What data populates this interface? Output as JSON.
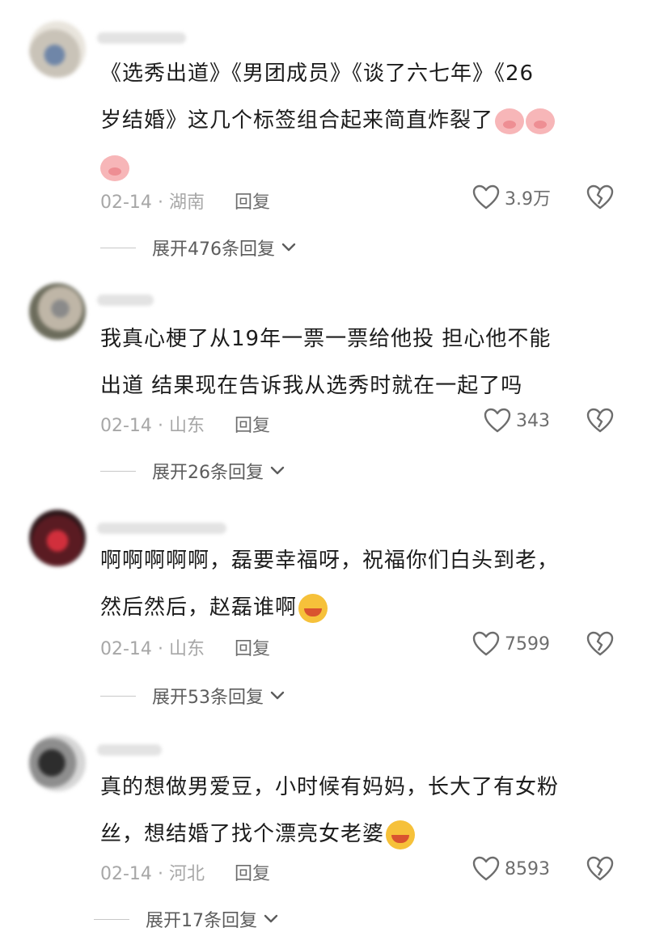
{
  "comments": [
    {
      "text_lines": [
        "《选秀出道》《男团成员》《谈了六七年》《26",
        "岁结婚》这几个标签组合起来简直炸裂了",
        ""
      ],
      "emoji": [
        "pig-emoji",
        "pig-emoji",
        "pig-emoji"
      ],
      "date": "02-14",
      "sep": "·",
      "location": "湖南",
      "reply_label": "回复",
      "likes": "3.9万",
      "expand_label": "展开476条回复"
    },
    {
      "text_lines": [
        "我真心梗了从19年一票一票给他投 担心他不能",
        "出道 结果现在告诉我从选秀时就在一起了吗"
      ],
      "date": "02-14",
      "sep": "·",
      "location": "山东",
      "reply_label": "回复",
      "likes": "343",
      "expand_label": "展开26条回复"
    },
    {
      "text_lines": [
        "啊啊啊啊啊，磊要幸福呀，祝福你们白头到老，",
        "然后然后，赵磊谁啊"
      ],
      "emoji": [
        "laughing-emoji"
      ],
      "date": "02-14",
      "sep": "·",
      "location": "山东",
      "reply_label": "回复",
      "likes": "7599",
      "expand_label": "展开53条回复"
    },
    {
      "text_lines": [
        "真的想做男爱豆，小时候有妈妈，长大了有女粉",
        "丝，想结婚了找个漂亮女老婆"
      ],
      "emoji": [
        "grin-emoji"
      ],
      "date": "02-14",
      "sep": "·",
      "location": "河北",
      "reply_label": "回复",
      "likes": "8593",
      "expand_label": "展开17条回复"
    }
  ],
  "icons": {
    "like": "heart-icon",
    "dislike": "broken-heart-icon",
    "expand": "chevron-down-icon"
  },
  "colors": {
    "text": "#1c1c1c",
    "meta": "#a7a7a7",
    "action": "#6d6d6d",
    "pig": "#f7b6b8",
    "face": "#f6c13a"
  }
}
